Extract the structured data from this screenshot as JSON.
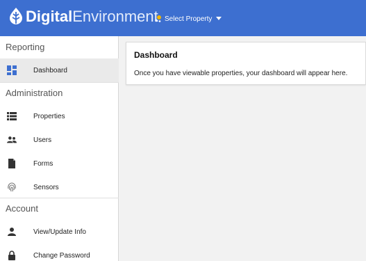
{
  "header": {
    "brand_bold": "Digital",
    "brand_light": "Environment",
    "property_select_label": "Select Property",
    "logo_icon": "leaf-drop-icon",
    "background_color": "#3d6fd0"
  },
  "sidebar": {
    "sections": [
      {
        "title": "Reporting",
        "items": [
          {
            "label": "Dashboard",
            "icon": "dashboard-icon",
            "active": true
          }
        ]
      },
      {
        "title": "Administration",
        "items": [
          {
            "label": "Properties",
            "icon": "list-icon"
          },
          {
            "label": "Users",
            "icon": "users-icon"
          },
          {
            "label": "Forms",
            "icon": "document-icon"
          },
          {
            "label": "Sensors",
            "icon": "fingerprint-icon"
          }
        ]
      },
      {
        "title": "Account",
        "items": [
          {
            "label": "View/Update Info",
            "icon": "person-icon"
          },
          {
            "label": "Change Password",
            "icon": "lock-icon"
          }
        ]
      }
    ]
  },
  "main": {
    "card_title": "Dashboard",
    "card_message": "Once you have viewable properties, your dashboard will appear here."
  }
}
